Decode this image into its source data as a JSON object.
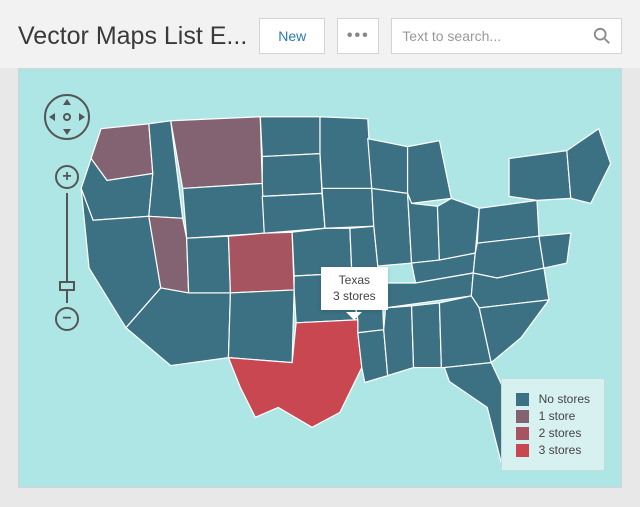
{
  "header": {
    "title": "Vector Maps List E...",
    "new_label": "New",
    "search_placeholder": "Text to search..."
  },
  "map": {
    "colors": {
      "no_stores": "#3c7183",
      "one_store": "#836372",
      "two_stores": "#a65560",
      "three_stores": "#c84750",
      "water": "#aee6e6"
    },
    "highlighted_states": {
      "WA": "one_store",
      "MT": "one_store",
      "NV": "one_store",
      "CO": "two_stores",
      "TX": "three_stores"
    },
    "tooltip": {
      "state": "Texas",
      "detail": "3 stores"
    },
    "legend": [
      {
        "label": "No stores",
        "color": "#3c7183"
      },
      {
        "label": "1 store",
        "color": "#836372"
      },
      {
        "label": "2 stores",
        "color": "#a65560"
      },
      {
        "label": "3 stores",
        "color": "#c84750"
      }
    ]
  }
}
